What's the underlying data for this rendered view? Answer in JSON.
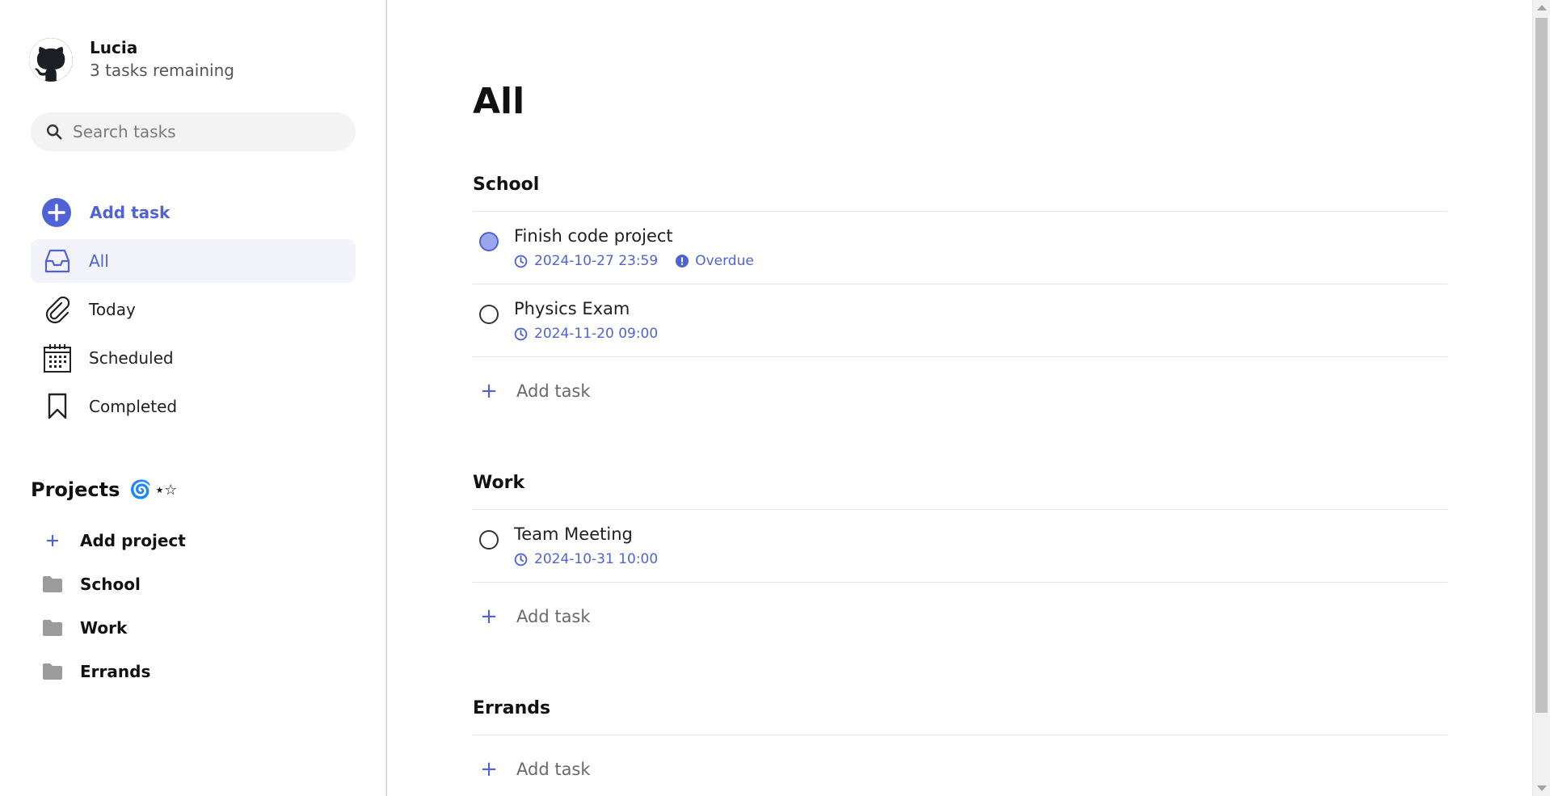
{
  "user": {
    "name": "Lucia",
    "tasks_remaining": "3 tasks remaining"
  },
  "search": {
    "placeholder": "Search tasks",
    "value": ""
  },
  "nav": {
    "add_task": "Add task",
    "items": [
      {
        "label": "All",
        "icon": "inbox-icon",
        "active": true
      },
      {
        "label": "Today",
        "icon": "paperclip-icon",
        "active": false
      },
      {
        "label": "Scheduled",
        "icon": "calendar-icon",
        "active": false
      },
      {
        "label": "Completed",
        "icon": "bookmark-icon",
        "active": false
      }
    ]
  },
  "projects": {
    "title": "Projects",
    "emoji": "🌀",
    "stars": "⋆☆",
    "add_label": "Add project",
    "items": [
      {
        "label": "School",
        "icon": "folder-icon"
      },
      {
        "label": "Work",
        "icon": "folder-icon"
      },
      {
        "label": "Errands",
        "icon": "folder-icon"
      }
    ]
  },
  "main": {
    "title": "All",
    "add_task_label": "Add task",
    "sections": [
      {
        "name": "School",
        "tasks": [
          {
            "title": "Finish code project",
            "due": "2024-10-27 23:59",
            "status": "Overdue",
            "priority": true
          },
          {
            "title": "Physics Exam",
            "due": "2024-11-20 09:00",
            "status": "",
            "priority": false
          }
        ]
      },
      {
        "name": "Work",
        "tasks": [
          {
            "title": "Team Meeting",
            "due": "2024-10-31 10:00",
            "status": "",
            "priority": false
          }
        ]
      },
      {
        "name": "Errands",
        "tasks": []
      }
    ]
  },
  "colors": {
    "accent": "#5063d6",
    "active_bg": "#f3f3fb",
    "priority_fill": "#9aa6ee"
  }
}
